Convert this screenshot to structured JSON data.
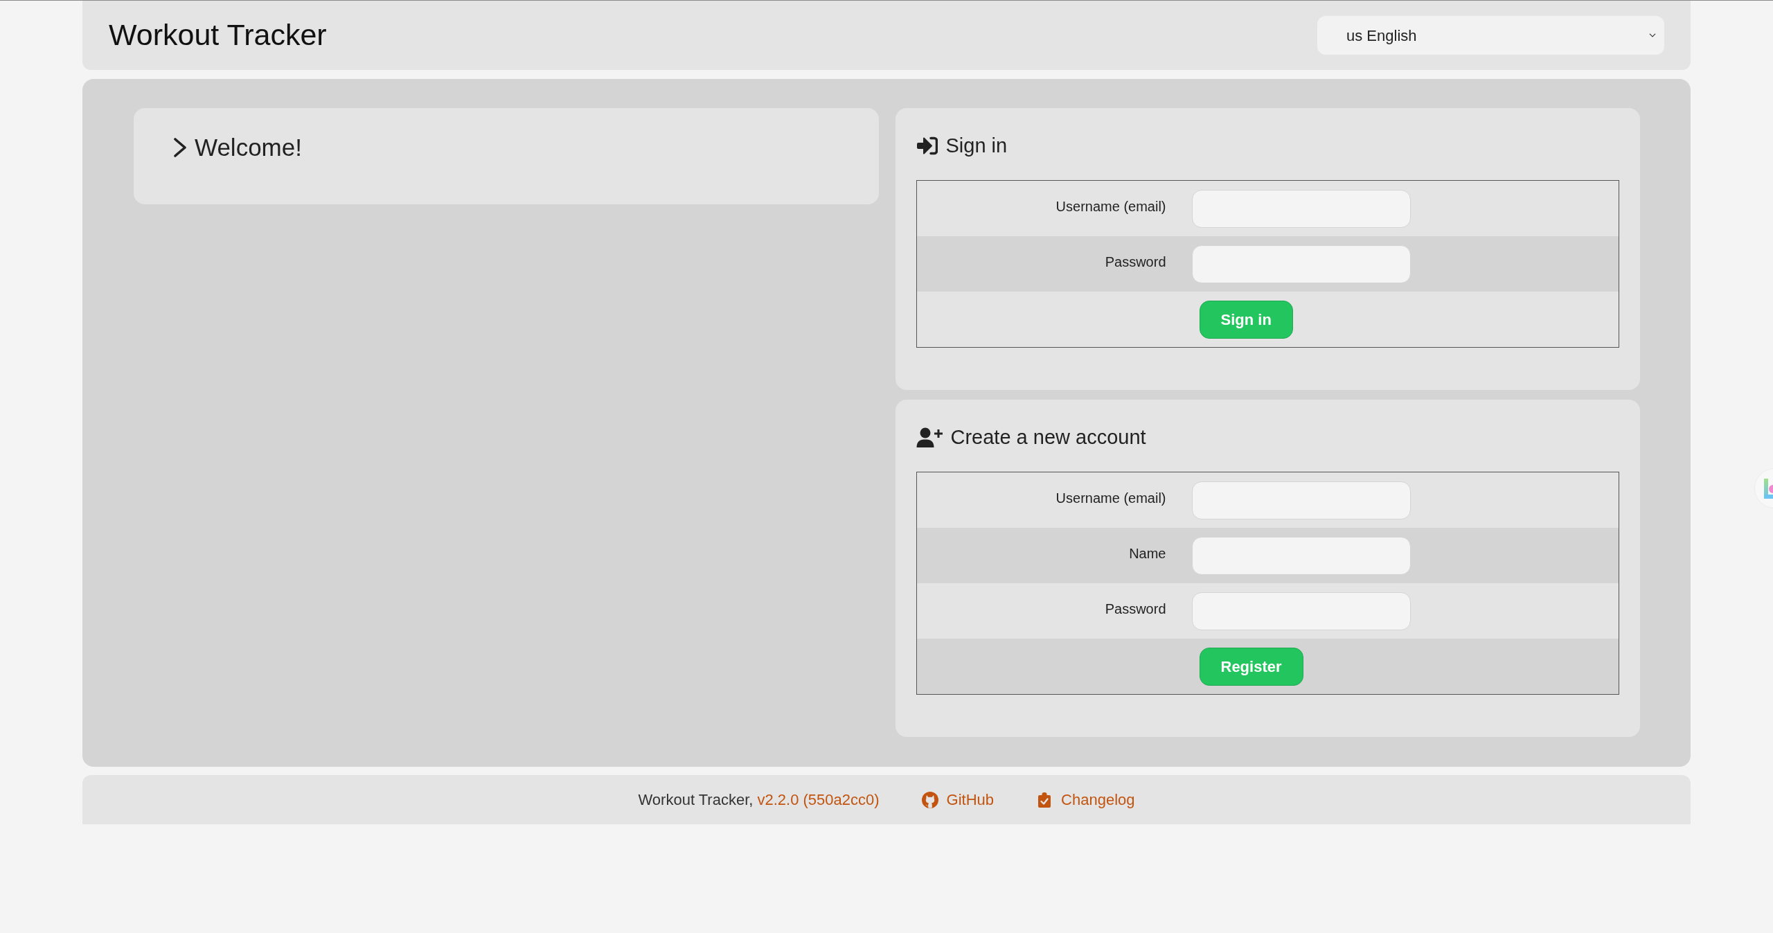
{
  "header": {
    "title": "Workout Tracker",
    "language": "us English"
  },
  "welcome": {
    "title": "Welcome!",
    "expanded": false
  },
  "sign_in": {
    "title": "Sign in",
    "fields": [
      {
        "label": "Username (email)"
      },
      {
        "label": "Password"
      }
    ],
    "button": "Sign in"
  },
  "create_account": {
    "title": "Create a new account",
    "fields": [
      {
        "label": "Username (email)"
      },
      {
        "label": "Name"
      },
      {
        "label": "Password"
      }
    ],
    "button": "Register"
  },
  "footer": {
    "app_name": "Workout Tracker,",
    "version": "v2.2.0 (550a2cc0)",
    "github_link": "GitHub",
    "changelog_link": "Changelog"
  }
}
